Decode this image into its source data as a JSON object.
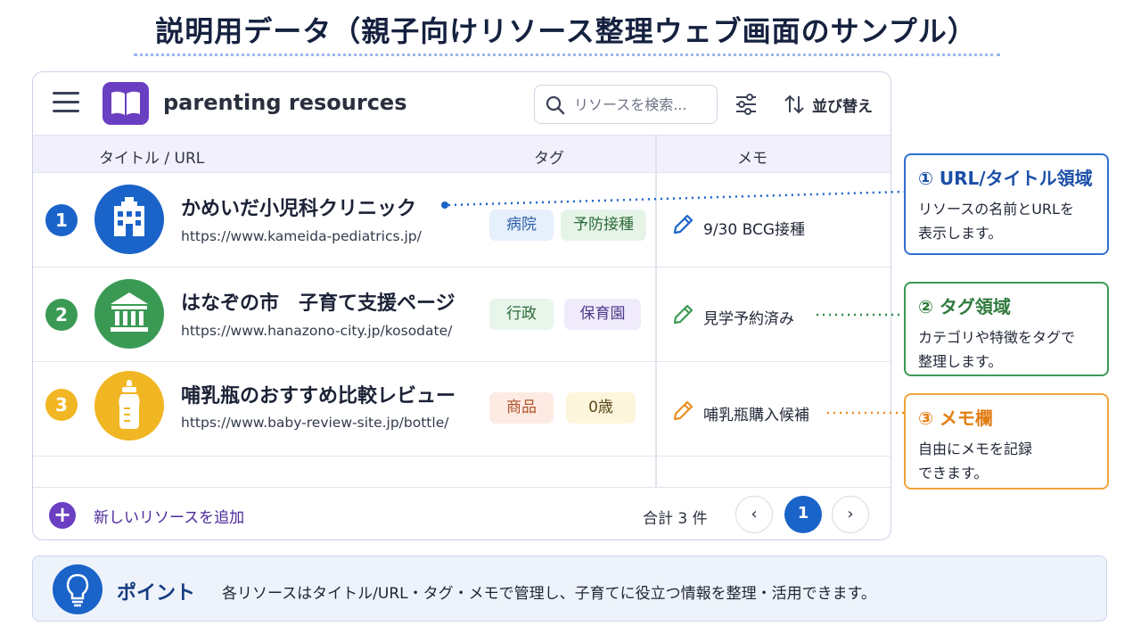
{
  "page": {
    "title": "説明用データ（親子向けリソース整理ウェブ画面のサンプル）"
  },
  "app": {
    "name": "parenting resources",
    "search_placeholder": "リソースを検索...",
    "sort_label": "並び替え",
    "columns": {
      "title_url": "タイトル / URL",
      "tags": "タグ",
      "memo": "メモ"
    },
    "resources": [
      {
        "num": "1",
        "icon": "hospital-icon",
        "color": "#1a63c9",
        "title": "かめいだ小児科クリニック",
        "url": "https://www.kameida-pediatrics.jp/",
        "tags": [
          {
            "label": "病院",
            "bg": "#e6effc",
            "fg": "#2c5fa8"
          },
          {
            "label": "予防接種",
            "bg": "#e6f4e8",
            "fg": "#2e6a38"
          }
        ],
        "memo": "9/30 BCG接種",
        "memo_color": "#1a63c9"
      },
      {
        "num": "2",
        "icon": "government-building-icon",
        "color": "#3a9a54",
        "title": "はなぞの市　子育て支援ページ",
        "url": "https://www.hanazono-city.jp/kosodate/",
        "tags": [
          {
            "label": "行政",
            "bg": "#e7f5ea",
            "fg": "#2e6a38"
          },
          {
            "label": "保育園",
            "bg": "#efebfa",
            "fg": "#4b3a8a"
          }
        ],
        "memo": "見学予約済み",
        "memo_color": "#3a9a54"
      },
      {
        "num": "3",
        "icon": "baby-bottle-icon",
        "color": "#f1b623",
        "title": "哺乳瓶のおすすめ比較レビュー",
        "url": "https://www.baby-review-site.jp/bottle/",
        "tags": [
          {
            "label": "商品",
            "bg": "#fdebe3",
            "fg": "#b0532a"
          },
          {
            "label": "0歳",
            "bg": "#fdf5dc",
            "fg": "#5a4a1a"
          }
        ],
        "memo": "哺乳瓶購入候補",
        "memo_color": "#ea8f22"
      }
    ],
    "add_label": "新しいリソースを追加",
    "count_label": "合計 3 件",
    "pagination": {
      "prev": "‹",
      "current": "1",
      "next": "›"
    }
  },
  "callouts": [
    {
      "title": "① URL/タイトル領域",
      "line1": "リソースの名前とURLを",
      "line2": "表示します。",
      "color": "#1a63c9"
    },
    {
      "title": "② タグ領域",
      "line1": "カテゴリや特徴をタグで",
      "line2": "整理します。",
      "color": "#2f8a45"
    },
    {
      "title": "③ メモ欄",
      "line1": "自由にメモを記録",
      "line2": "できます。",
      "color": "#ea8f22"
    }
  ],
  "point": {
    "label": "ポイント",
    "text": "各リソースはタイトル/URL・タグ・メモで管理し、子育てに役立つ情報を整理・活用できます。"
  }
}
